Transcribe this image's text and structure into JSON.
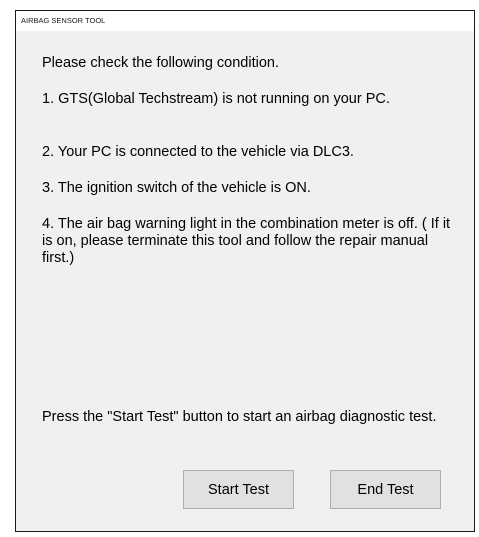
{
  "window": {
    "title": "AIRBAG SENSOR TOOL"
  },
  "instructions": {
    "intro": "Please check the following condition.",
    "conditions": [
      "1. GTS(Global Techstream) is not running on your PC.",
      "2. Your PC is connected to the vehicle via DLC3.",
      "3. The ignition switch of the vehicle is ON.",
      "4. The air bag warning light in the combination meter is off. ( If it is on, please terminate this tool and follow the repair manual first.)"
    ],
    "prompt": "Press the \"Start Test\" button to start an airbag diagnostic test."
  },
  "buttons": {
    "start_label": "Start Test",
    "end_label": "End Test"
  }
}
